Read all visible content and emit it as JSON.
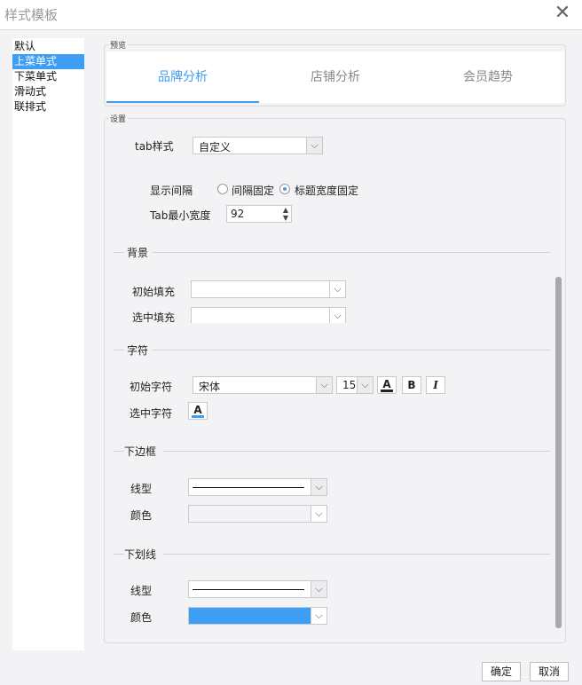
{
  "window": {
    "title": "样式模板"
  },
  "styles_list": [
    {
      "label": "默认",
      "selected": false
    },
    {
      "label": "上菜单式",
      "selected": true
    },
    {
      "label": "下菜单式",
      "selected": false
    },
    {
      "label": "滑动式",
      "selected": false
    },
    {
      "label": "联排式",
      "selected": false
    }
  ],
  "preview": {
    "label": "预览",
    "tabs": [
      "品牌分析",
      "店铺分析",
      "会员趋势"
    ],
    "active_tab": 0
  },
  "settings": {
    "label": "设置",
    "tab_style": {
      "label": "tab样式",
      "value": "自定义"
    },
    "spacing": {
      "label": "显示间隔",
      "options": [
        "间隔固定",
        "标题宽度固定"
      ],
      "selected": 1
    },
    "min_width": {
      "label": "Tab最小宽度",
      "value": "92"
    },
    "background": {
      "title": "背景",
      "initial_fill": "初始填充",
      "selected_fill": "选中填充"
    },
    "font": {
      "title": "字符",
      "initial_label": "初始字符",
      "font_name": "宋体",
      "font_size": "15",
      "color_glyph": "A",
      "bold_glyph": "B",
      "italic_glyph": "I",
      "selected_label": "选中字符"
    },
    "bottom_border": {
      "title": "下边框",
      "line_label": "线型",
      "color_label": "颜色"
    },
    "underline": {
      "title": "下划线",
      "line_label": "线型",
      "color_label": "颜色",
      "color": "#3e9ef6"
    }
  },
  "buttons": {
    "ok": "确定",
    "cancel": "取消"
  },
  "colors": {
    "accent": "#3e9ef6"
  }
}
